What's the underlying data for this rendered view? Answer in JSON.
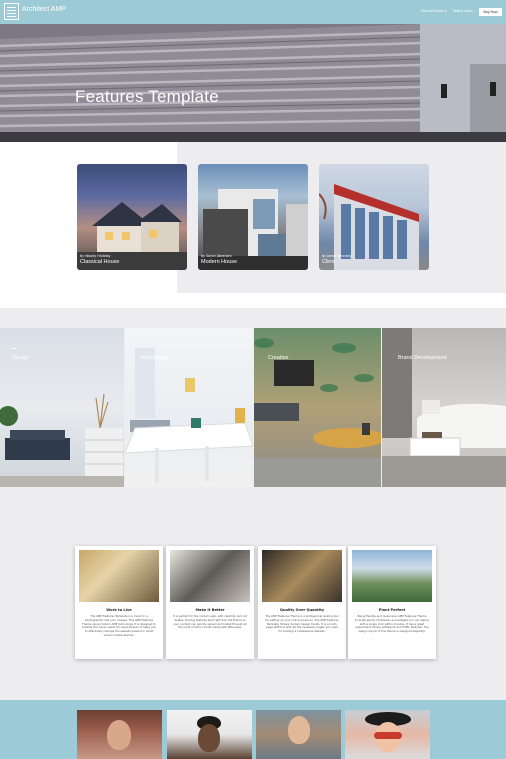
{
  "nav": {
    "logo_text": "Architect AMP",
    "links": [
      "View All Demo ▾",
      "Watch Video"
    ],
    "cta_label": "Buy Now"
  },
  "hero": {
    "title": "Features Template"
  },
  "projects": [
    {
      "author": "by Woody Halliday",
      "title": "Classical House"
    },
    {
      "author": "by Sarah Abraham",
      "title": "Modern House"
    },
    {
      "author": "by Jamie Kennedy",
      "title": "Clinic"
    }
  ],
  "categories": [
    "Design",
    "Technology",
    "Creative",
    "Brand Development"
  ],
  "features": [
    {
      "title": "Work to Live",
      "text": "The AMP Features Template is a must for a photographer and your images. This AMP Features Theme using modern AMP technology. It is designed to simplify the visual needs for requirements. It helps you to effectively manage the website present in small screen mobile devices."
    },
    {
      "title": "Make It Better",
      "text": "It is perfect for the modern web, with carefully laid out details, sharing features built right into the theme so your content can quickly spread and install through all the most common social media with little ease."
    },
    {
      "title": "Quality Over Quantity",
      "text": "The AMP Features Theme is a professional looking tool for setting up your online presence. The AMP Features Template follows modern design trends. It is a multi-page AMP tool with all the necessary pages you need for building a professional website."
    },
    {
      "title": "Plant Perfect",
      "text": "Being flexible and responsive AMP Features Theme includes plenty of features and widgets you can deploy with a single click within minutes. It has a great experiment mixing whitework and HTML features. The design layout of this theme is designed elegantly."
    }
  ],
  "colors": {
    "nav_bg": "#9ccad6",
    "section_grey": "#edecef",
    "accent": "#ffffff"
  }
}
